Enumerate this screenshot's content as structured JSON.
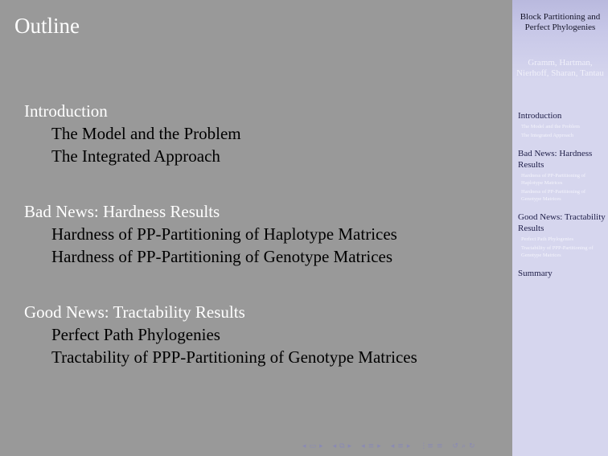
{
  "frame": {
    "title": "Outline"
  },
  "toc": {
    "sections": [
      {
        "label": "Introduction",
        "subsections": [
          "The Model and the Problem",
          "The Integrated Approach"
        ]
      },
      {
        "label": "Bad News: Hardness Results",
        "subsections": [
          "Hardness of PP-Partitioning of Haplotype Matrices",
          "Hardness of PP-Partitioning of Genotype Matrices"
        ]
      },
      {
        "label": "Good News: Tractability Results",
        "subsections": [
          "Perfect Path Phylogenies",
          "Tractability of PPP-Partitioning of Genotype Matrices"
        ]
      }
    ]
  },
  "sidebar": {
    "title": "Block Partitioning and Perfect Phylogenies",
    "authors": "Gramm, Hartman, Nierhoff, Sharan, Tantau",
    "nav": {
      "intro": "Introduction",
      "intro_sub1": "The Model and the Problem",
      "intro_sub2": "The Integrated Approach",
      "bad": "Bad News: Hardness Results",
      "bad_sub1": "Hardness of PP-Partitioning of Haplotype Matrices",
      "bad_sub2": "Hardness of PP-Partitioning of Genotype Matrices",
      "good": "Good News: Tractability Results",
      "good_sub1": "Perfect Path Phylogenies",
      "good_sub2": "Tractability of PPP-Partitioning of Genotype Matrices",
      "summary": "Summary"
    }
  },
  "navbar": {
    "colors": {
      "icon": "#8a8ab4"
    },
    "icons": [
      "frame-nav",
      "subsection-nav",
      "section-nav",
      "presentation-nav",
      "search-controls"
    ]
  }
}
